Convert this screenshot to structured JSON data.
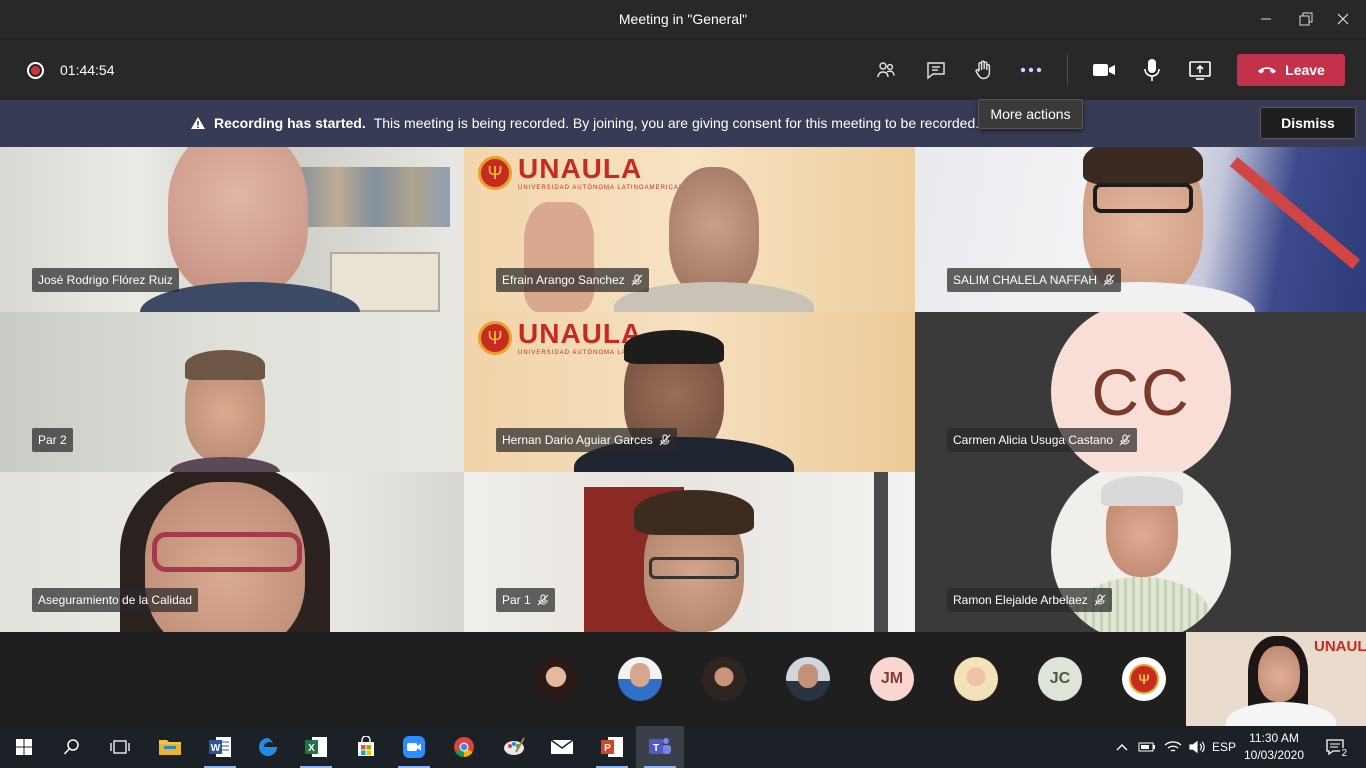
{
  "window": {
    "title": "Meeting in \"General\""
  },
  "toolbar": {
    "timer": "01:44:54",
    "leave_label": "Leave",
    "tooltip": "More actions"
  },
  "banner": {
    "bold": "Recording has started.",
    "text": "This meeting is being recorded. By joining, you are giving consent for this meeting to be recorded.",
    "dismiss_label": "Dismiss"
  },
  "brand": {
    "logo_word": "UNAULA",
    "logo_sub": "UNIVERSIDAD AUTÓNOMA LATINOAMERICANA",
    "logo_glyph": "Ψ"
  },
  "participants": [
    {
      "name": "José Rodrigo Flórez Ruiz",
      "muted": false
    },
    {
      "name": "Efrain Arango Sanchez",
      "muted": true
    },
    {
      "name": "SALIM CHALELA NAFFAH",
      "muted": true
    },
    {
      "name": "Par 2",
      "muted": false
    },
    {
      "name": "Hernan Dario Aguiar Garces",
      "muted": true
    },
    {
      "name": "Carmen Alicia Usuga Castano",
      "muted": true,
      "initials": "CC"
    },
    {
      "name": "Aseguramiento de la Calidad",
      "muted": false
    },
    {
      "name": "Par 1",
      "muted": true
    },
    {
      "name": "Ramon Elejalde Arbelaez",
      "muted": true
    }
  ],
  "strip_initials": {
    "jm": "JM",
    "jc": "JC"
  },
  "selfview_brand": "UNAULA",
  "taskbar": {
    "language": "ESP",
    "time": "11:30 AM",
    "date": "10/03/2020",
    "notifications": "2"
  },
  "colors": {
    "leave": "#c4314b",
    "banner": "#373b55",
    "recording": "#d13438",
    "unaula_red": "#c72a20"
  }
}
